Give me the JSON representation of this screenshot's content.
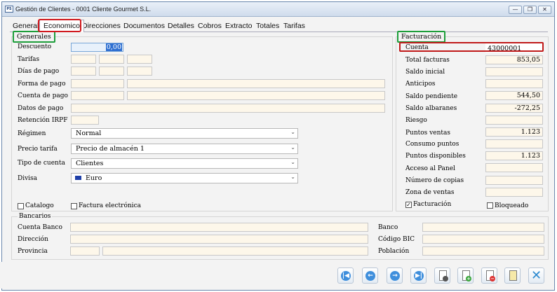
{
  "window": {
    "app_icon": "PS",
    "title": "Gestión de Clientes - 0001 Cliente Gourmet S.L.",
    "minimize_icon": "—",
    "restore_icon": "❐",
    "close_icon": "✕"
  },
  "tabs": [
    "General",
    "Economico",
    "Direcciones",
    "Documentos",
    "Detalles",
    "Cobros",
    "Extracto",
    "Totales",
    "Tarifas"
  ],
  "active_tab": "Economico",
  "generales": {
    "title": "Generales",
    "descuento_label": "Descuento",
    "descuento_value": "0,00",
    "tarifas_label": "Tarifas",
    "dias_pago_label": "Días de pago",
    "forma_pago_label": "Forma de pago",
    "cuenta_pago_label": "Cuenta de pago",
    "datos_pago_label": "Datos de pago",
    "retencion_label": "Retención IRPF",
    "regimen_label": "Régimen",
    "regimen_value": "Normal",
    "precio_tarifa_label": "Precio tarifa",
    "precio_tarifa_value": "Precio de almacén 1",
    "tipo_cuenta_label": "Tipo de cuenta",
    "tipo_cuenta_value": "Clientes",
    "divisa_label": "Divisa",
    "divisa_value": "Euro",
    "catalogo_label": "Catalogo",
    "factura_electronica_label": "Factura electrónica"
  },
  "facturacion": {
    "title": "Facturación",
    "cuenta_label": "Cuenta",
    "cuenta_value": "43000001",
    "total_facturas_label": "Total facturas",
    "total_facturas_value": "853,05",
    "saldo_inicial_label": "Saldo inicial",
    "anticipos_label": "Anticipos",
    "saldo_pendiente_label": "Saldo pendiente",
    "saldo_pendiente_value": "544,50",
    "saldo_albaranes_label": "Saldo albaranes",
    "saldo_albaranes_value": "-272,25",
    "riesgo_label": "Riesgo",
    "puntos_ventas_label": "Puntos ventas",
    "puntos_ventas_value": "1.123",
    "consumo_puntos_label": "Consumo puntos",
    "puntos_disponibles_label": "Puntos disponibles",
    "puntos_disponibles_value": "1.123",
    "acceso_panel_label": "Acceso al Panel",
    "numero_copias_label": "Número de copias",
    "zona_ventas_label": "Zona de ventas",
    "facturacion_check_label": "Facturación",
    "facturacion_checked": true,
    "bloqueado_label": "Bloqueado",
    "bloqueado_checked": false
  },
  "bancarios": {
    "title": "Bancarios",
    "cuenta_banco_label": "Cuenta Banco",
    "banco_label": "Banco",
    "direccion_label": "Dirección",
    "codigo_bic_label": "Código BIC",
    "provincia_label": "Provincia",
    "poblacion_label": "Población"
  },
  "toolbar": {
    "first_icon": "|◀",
    "prev_icon": "←",
    "next_icon": "→",
    "last_icon": "▶|",
    "close_icon": "✕"
  },
  "colors": {
    "highlight_red": "#d0191e",
    "highlight_green": "#1d9e3a",
    "field_bg": "#fdf7ea",
    "nav_blue": "#3f8fdc"
  }
}
